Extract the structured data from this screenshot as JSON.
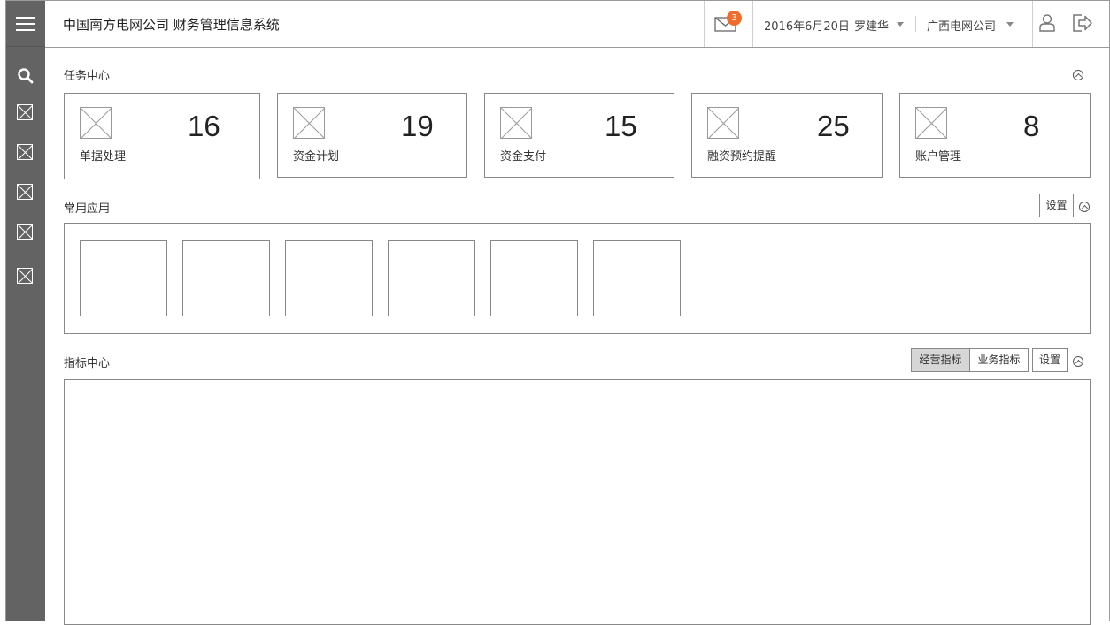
{
  "header": {
    "title": "中国南方电网公司 财务管理信息系统",
    "mail_badge": "3",
    "date": "2016年6月20日",
    "user": "罗建华",
    "company": "广西电网公司"
  },
  "sidebar": {
    "items": [
      "search-icon",
      "image-placeholder-icon",
      "image-placeholder-icon",
      "image-placeholder-icon",
      "image-placeholder-icon",
      "image-placeholder-icon"
    ]
  },
  "task_center": {
    "title": "任务中心",
    "cards": [
      {
        "label": "单据处理",
        "count": "16"
      },
      {
        "label": "资金计划",
        "count": "19"
      },
      {
        "label": "资金支付",
        "count": "15"
      },
      {
        "label": "融资预约提醒",
        "count": "25"
      },
      {
        "label": "账户管理",
        "count": "8"
      }
    ]
  },
  "common_apps": {
    "title": "常用应用",
    "settings_label": "设置",
    "tile_count": 6
  },
  "indicator_center": {
    "title": "指标中心",
    "tabs": [
      {
        "label": "经营指标",
        "active": true
      },
      {
        "label": "业务指标",
        "active": false
      }
    ],
    "settings_label": "设置"
  },
  "colors": {
    "sidebar_bg": "#636363",
    "badge": "#ef6c2b",
    "border": "#888888"
  }
}
